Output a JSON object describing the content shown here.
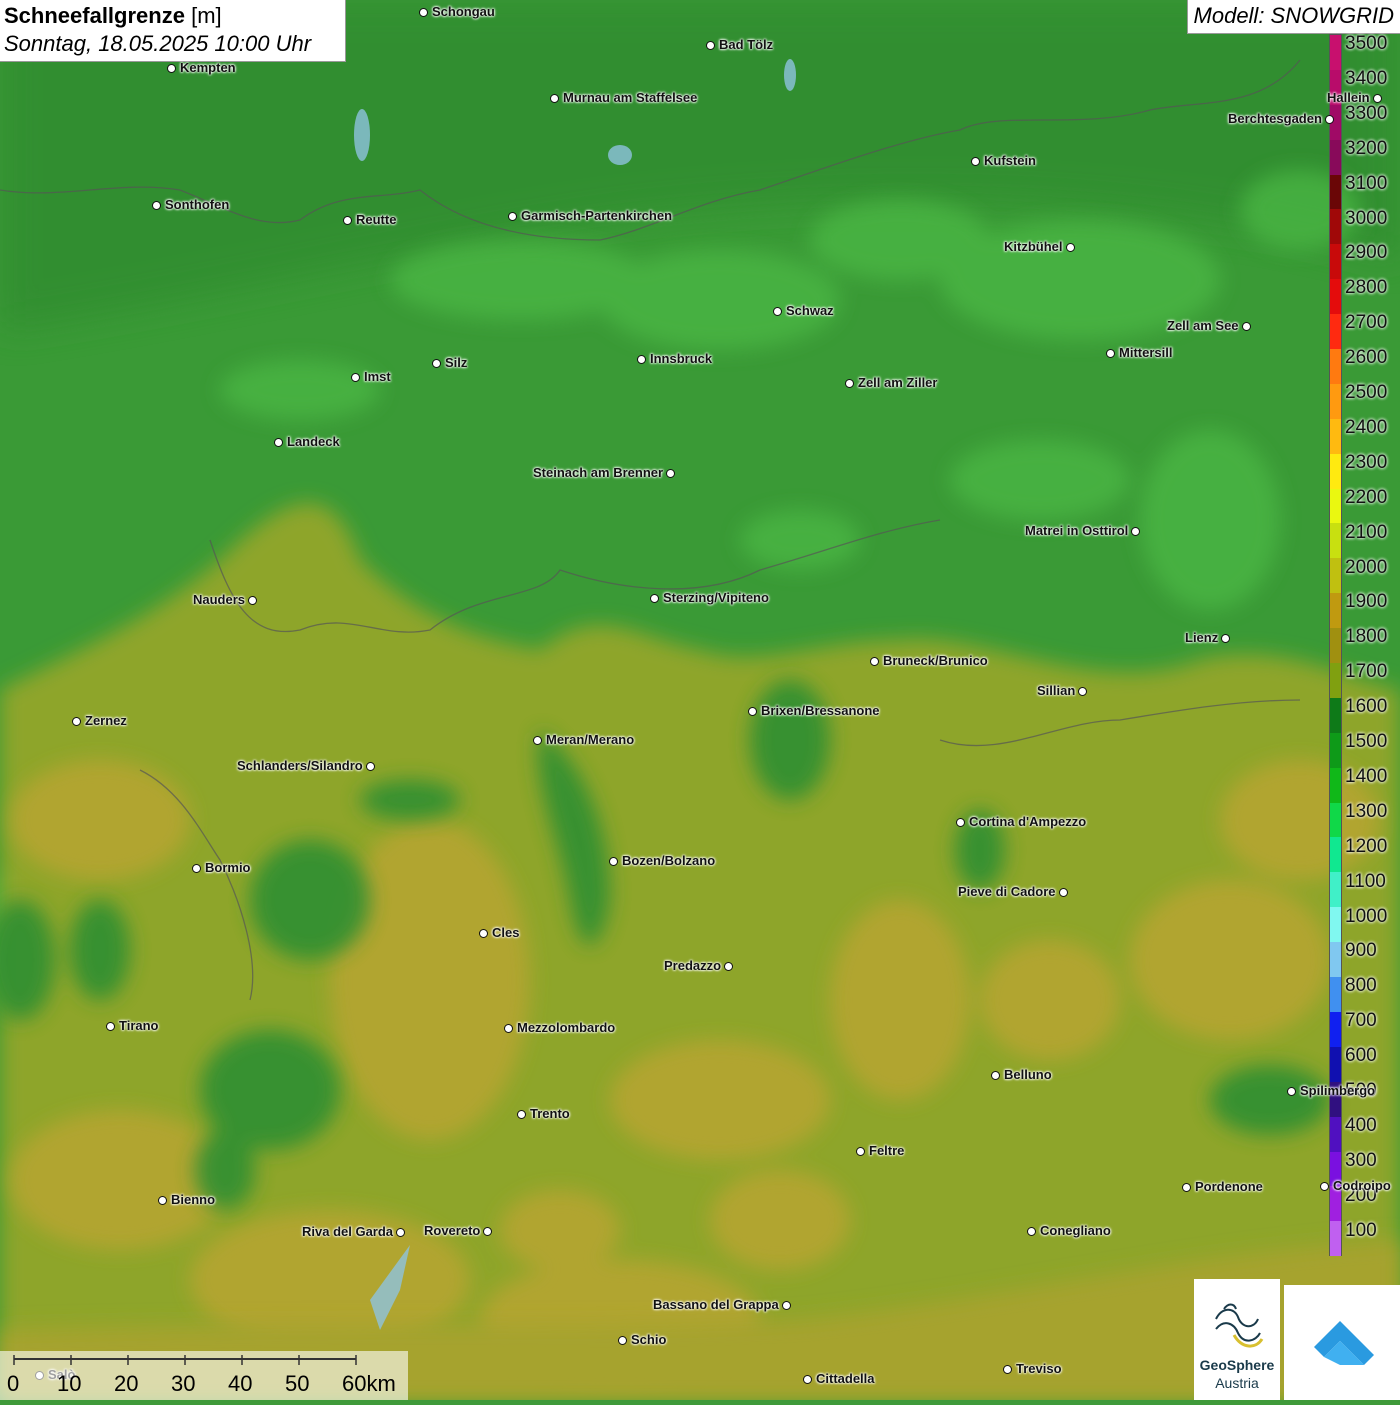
{
  "title": {
    "variable": "Schneefallgrenze",
    "unit": "[m]",
    "datetime": "Sonntag, 18.05.2025 10:00 Uhr"
  },
  "model_label": "Modell: SNOWGRID",
  "legend": {
    "labels": [
      "3500",
      "3400",
      "3300",
      "3200",
      "3100",
      "3000",
      "2900",
      "2800",
      "2700",
      "2600",
      "2500",
      "2400",
      "2300",
      "2200",
      "2100",
      "2000",
      "1900",
      "1800",
      "1700",
      "1600",
      "1500",
      "1400",
      "1300",
      "1200",
      "1100",
      "1000",
      "900",
      "800",
      "700",
      "600",
      "500",
      "400",
      "300",
      "200",
      "100"
    ],
    "colors": [
      "#c8106e",
      "#b80c6a",
      "#a00a66",
      "#880a5a",
      "#6a0606",
      "#a00808",
      "#c80a0a",
      "#e40c0c",
      "#ff2a10",
      "#ff7a10",
      "#ff9a10",
      "#ffba10",
      "#ffea10",
      "#eaf810",
      "#c8e010",
      "#c0c010",
      "#c09a10",
      "#a09010",
      "#80a010",
      "#0e7a18",
      "#0e9a18",
      "#10b818",
      "#10d848",
      "#10e890",
      "#40f0c8",
      "#80f8f0",
      "#80c8f0",
      "#4090f0",
      "#1020f0",
      "#1010b0",
      "#301080",
      "#5010c0",
      "#7a10e0",
      "#a020e0",
      "#c060f0"
    ]
  },
  "cities": [
    {
      "name": "Schongau",
      "anchor": "right"
    },
    {
      "name": "Bad Tölz",
      "anchor": "right"
    },
    {
      "name": "Kempten",
      "anchor": "right"
    },
    {
      "name": "Murnau am Staffelsee",
      "anchor": "right"
    },
    {
      "name": "Hallein",
      "anchor": "left"
    },
    {
      "name": "Berchtesgaden",
      "anchor": "left"
    },
    {
      "name": "Kufstein",
      "anchor": "right"
    },
    {
      "name": "Sonthofen",
      "anchor": "right"
    },
    {
      "name": "Reutte",
      "anchor": "right"
    },
    {
      "name": "Garmisch-Partenkirchen",
      "anchor": "right"
    },
    {
      "name": "Kitzbühel",
      "anchor": "left"
    },
    {
      "name": "Schwaz",
      "anchor": "right"
    },
    {
      "name": "Zell am See",
      "anchor": "left"
    },
    {
      "name": "Innsbruck",
      "anchor": "right"
    },
    {
      "name": "Mittersill",
      "anchor": "right"
    },
    {
      "name": "Silz",
      "anchor": "right"
    },
    {
      "name": "Imst",
      "anchor": "right"
    },
    {
      "name": "Zell am Ziller",
      "anchor": "right"
    },
    {
      "name": "Landeck",
      "anchor": "right"
    },
    {
      "name": "Steinach am Brenner",
      "anchor": "left"
    },
    {
      "name": "Matrei in Osttirol",
      "anchor": "left"
    },
    {
      "name": "Nauders",
      "anchor": "left"
    },
    {
      "name": "Sterzing/Vipiteno",
      "anchor": "right"
    },
    {
      "name": "Lienz",
      "anchor": "left"
    },
    {
      "name": "Bruneck/Brunico",
      "anchor": "right"
    },
    {
      "name": "Sillian",
      "anchor": "left"
    },
    {
      "name": "Brixen/Bressanone",
      "anchor": "right"
    },
    {
      "name": "Zernez",
      "anchor": "right"
    },
    {
      "name": "Meran/Merano",
      "anchor": "right"
    },
    {
      "name": "Schlanders/Silandro",
      "anchor": "left"
    },
    {
      "name": "Cortina d'Ampezzo",
      "anchor": "right"
    },
    {
      "name": "Bozen/Bolzano",
      "anchor": "right"
    },
    {
      "name": "Bormio",
      "anchor": "right"
    },
    {
      "name": "Pieve di Cadore",
      "anchor": "left"
    },
    {
      "name": "Cles",
      "anchor": "right"
    },
    {
      "name": "Predazzo",
      "anchor": "left"
    },
    {
      "name": "Tirano",
      "anchor": "right"
    },
    {
      "name": "Mezzolombardo",
      "anchor": "right"
    },
    {
      "name": "Belluno",
      "anchor": "right"
    },
    {
      "name": "Spilimbergo",
      "anchor": "right"
    },
    {
      "name": "Trento",
      "anchor": "right"
    },
    {
      "name": "Feltre",
      "anchor": "right"
    },
    {
      "name": "Pordenone",
      "anchor": "right"
    },
    {
      "name": "Codroipo",
      "anchor": "right"
    },
    {
      "name": "Bienno",
      "anchor": "right"
    },
    {
      "name": "Riva del Garda",
      "anchor": "left"
    },
    {
      "name": "Rovereto",
      "anchor": "left"
    },
    {
      "name": "Conegliano",
      "anchor": "right"
    },
    {
      "name": "Bassano del Grappa",
      "anchor": "left"
    },
    {
      "name": "Schio",
      "anchor": "right"
    },
    {
      "name": "Salò",
      "anchor": "right"
    },
    {
      "name": "Treviso",
      "anchor": "right"
    },
    {
      "name": "Cittadella",
      "anchor": "right"
    }
  ],
  "scale_bar": {
    "labels": [
      "0",
      "10",
      "20",
      "30",
      "40",
      "50",
      "60km"
    ]
  },
  "logo": {
    "line1": "GeoSphere",
    "line2": "Austria"
  }
}
